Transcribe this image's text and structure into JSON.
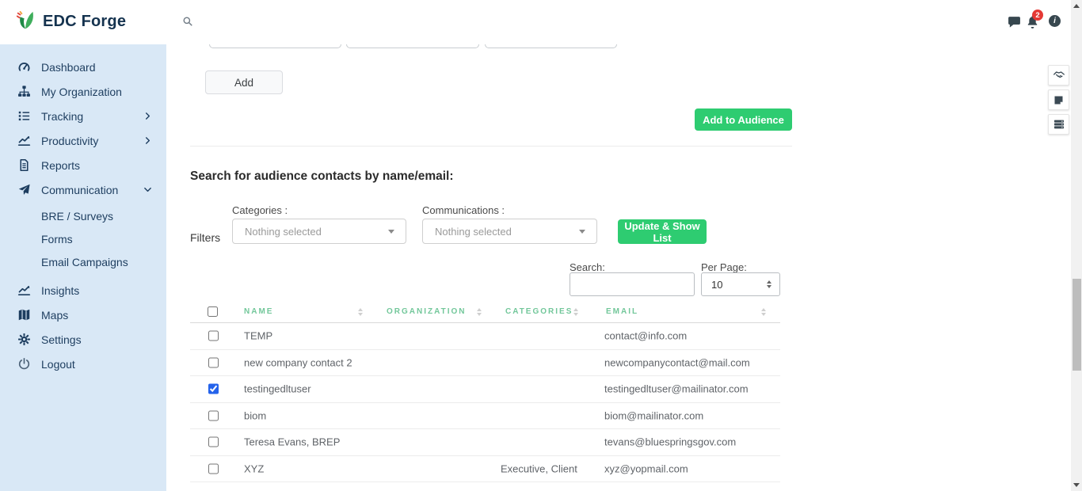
{
  "header": {
    "brand": "EDC Forge",
    "notification_badge": "2",
    "icons": {
      "search": "magnifier-icon",
      "chat": "chat-bubble-icon",
      "bell": "bell-icon",
      "info": "info-icon"
    }
  },
  "sidebar": {
    "items": [
      {
        "label": "Dashboard",
        "icon": "gauge-icon"
      },
      {
        "label": "My Organization",
        "icon": "org-chart-icon"
      },
      {
        "label": "Tracking",
        "icon": "list-icon",
        "chevron": "right"
      },
      {
        "label": "Productivity",
        "icon": "chart-line-icon",
        "chevron": "right"
      },
      {
        "label": "Reports",
        "icon": "document-icon"
      },
      {
        "label": "Communication",
        "icon": "paper-plane-icon",
        "chevron": "down"
      },
      {
        "label": "Insights",
        "icon": "chart-line-icon"
      },
      {
        "label": "Maps",
        "icon": "map-icon"
      },
      {
        "label": "Settings",
        "icon": "gear-icon"
      },
      {
        "label": "Logout",
        "icon": "power-icon"
      }
    ],
    "communication_subitems": [
      {
        "label": "BRE / Surveys"
      },
      {
        "label": "Forms"
      },
      {
        "label": "Email Campaigns"
      }
    ]
  },
  "main": {
    "add_button": "Add",
    "add_to_audience_button": "Add to Audience",
    "heading": "Search for audience contacts by name/email:",
    "filters": {
      "label": "Filters",
      "categories_label": "Categories :",
      "categories_value": "Nothing selected",
      "communications_label": "Communications :",
      "communications_value": "Nothing selected",
      "update_button": "Update & Show List"
    },
    "search_label": "Search:",
    "search_value": "",
    "per_page_label": "Per Page:",
    "per_page_value": "10",
    "table": {
      "headers": [
        "NAME",
        "ORGANIZATION",
        "CATEGORIES",
        "EMAIL"
      ],
      "rows": [
        {
          "checked": false,
          "name": "TEMP",
          "organization": "",
          "categories": "",
          "email": "contact@info.com"
        },
        {
          "checked": false,
          "name": "new company contact 2",
          "organization": "",
          "categories": "",
          "email": "newcompanycontact@mail.com"
        },
        {
          "checked": true,
          "name": "testingedltuser",
          "organization": "",
          "categories": "",
          "email": "testingedltuser@mailinator.com"
        },
        {
          "checked": false,
          "name": "biom",
          "organization": "",
          "categories": "",
          "email": "biom@mailinator.com"
        },
        {
          "checked": false,
          "name": "Teresa Evans, BREP",
          "organization": "",
          "categories": "",
          "email": "tevans@bluespringsgov.com"
        },
        {
          "checked": false,
          "name": "XYZ",
          "organization": "",
          "categories": "Executive, Client",
          "email": "xyz@yopmail.com"
        }
      ]
    },
    "floating_tools": [
      "handshake-icon",
      "note-icon",
      "stacked-list-icon"
    ]
  },
  "colors": {
    "accent_green": "#2ecc71",
    "table_header_green": "#72c79a",
    "sidebar_bg": "#d9e8f6",
    "sidebar_text": "#1d3d5f",
    "badge_red": "#e53935",
    "checkbox_blue": "#2563eb"
  }
}
